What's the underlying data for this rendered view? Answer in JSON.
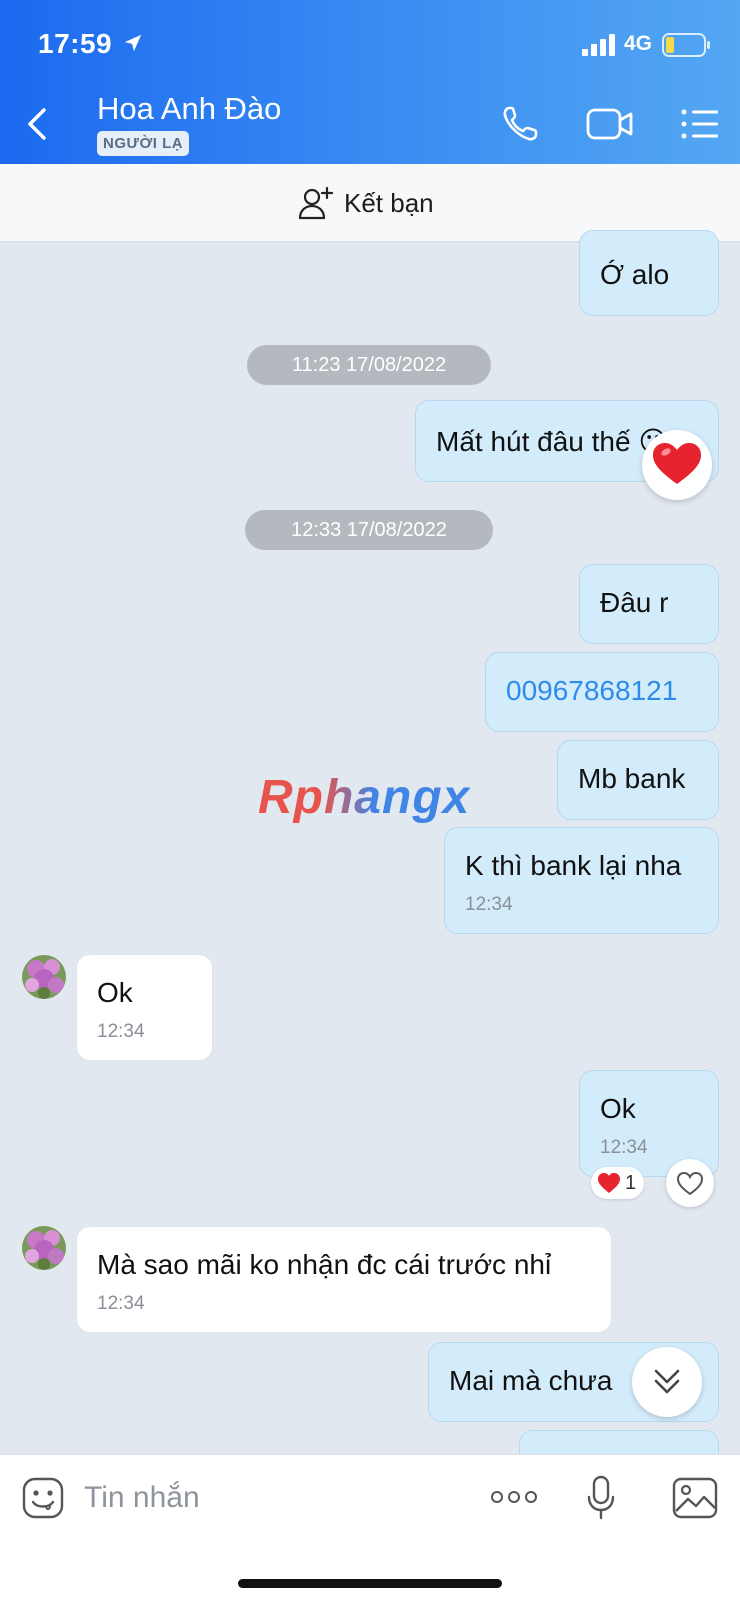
{
  "status_bar": {
    "time": "17:59",
    "network": "4G"
  },
  "header": {
    "contact_name": "Hoa Anh Đào",
    "badge": "NGƯỜI LẠ",
    "icons": [
      "back-icon",
      "phone-icon",
      "video-call-icon",
      "menu-icon"
    ]
  },
  "friend_bar": {
    "label": "Kết bạn"
  },
  "messages": [
    {
      "direction": "out",
      "text": "Ớ alo"
    },
    {
      "type": "date",
      "text": "11:23 17/08/2022"
    },
    {
      "direction": "out",
      "text": "Mất hút đâu thế 😕",
      "reaction": "heart"
    },
    {
      "type": "date",
      "text": "12:33 17/08/2022"
    },
    {
      "direction": "out",
      "text": "Đâu r"
    },
    {
      "direction": "out",
      "text": "00967868121",
      "is_link": true
    },
    {
      "direction": "out",
      "text": "Mb bank"
    },
    {
      "direction": "out",
      "text": "K thì bank lại nha",
      "time": "12:34"
    },
    {
      "direction": "in",
      "text": "Ok",
      "time": "12:34"
    },
    {
      "direction": "out",
      "text": "Ok",
      "time": "12:34",
      "reaction_count": "1"
    },
    {
      "direction": "in",
      "text": "Mà sao mãi ko nhận đc cái trước nhỉ",
      "time": "12:34"
    },
    {
      "direction": "out",
      "text": "Mai mà chưa"
    }
  ],
  "watermark": "Rphangx",
  "input_bar": {
    "placeholder": "Tin nhắn"
  },
  "colors": {
    "header_start": "#1b6af0",
    "header_end": "#54a7f2",
    "outgoing_bubble": "#d3ecfb",
    "incoming_bubble": "#ffffff",
    "chat_background": "#e2e8f0",
    "link": "#2e8bea"
  }
}
